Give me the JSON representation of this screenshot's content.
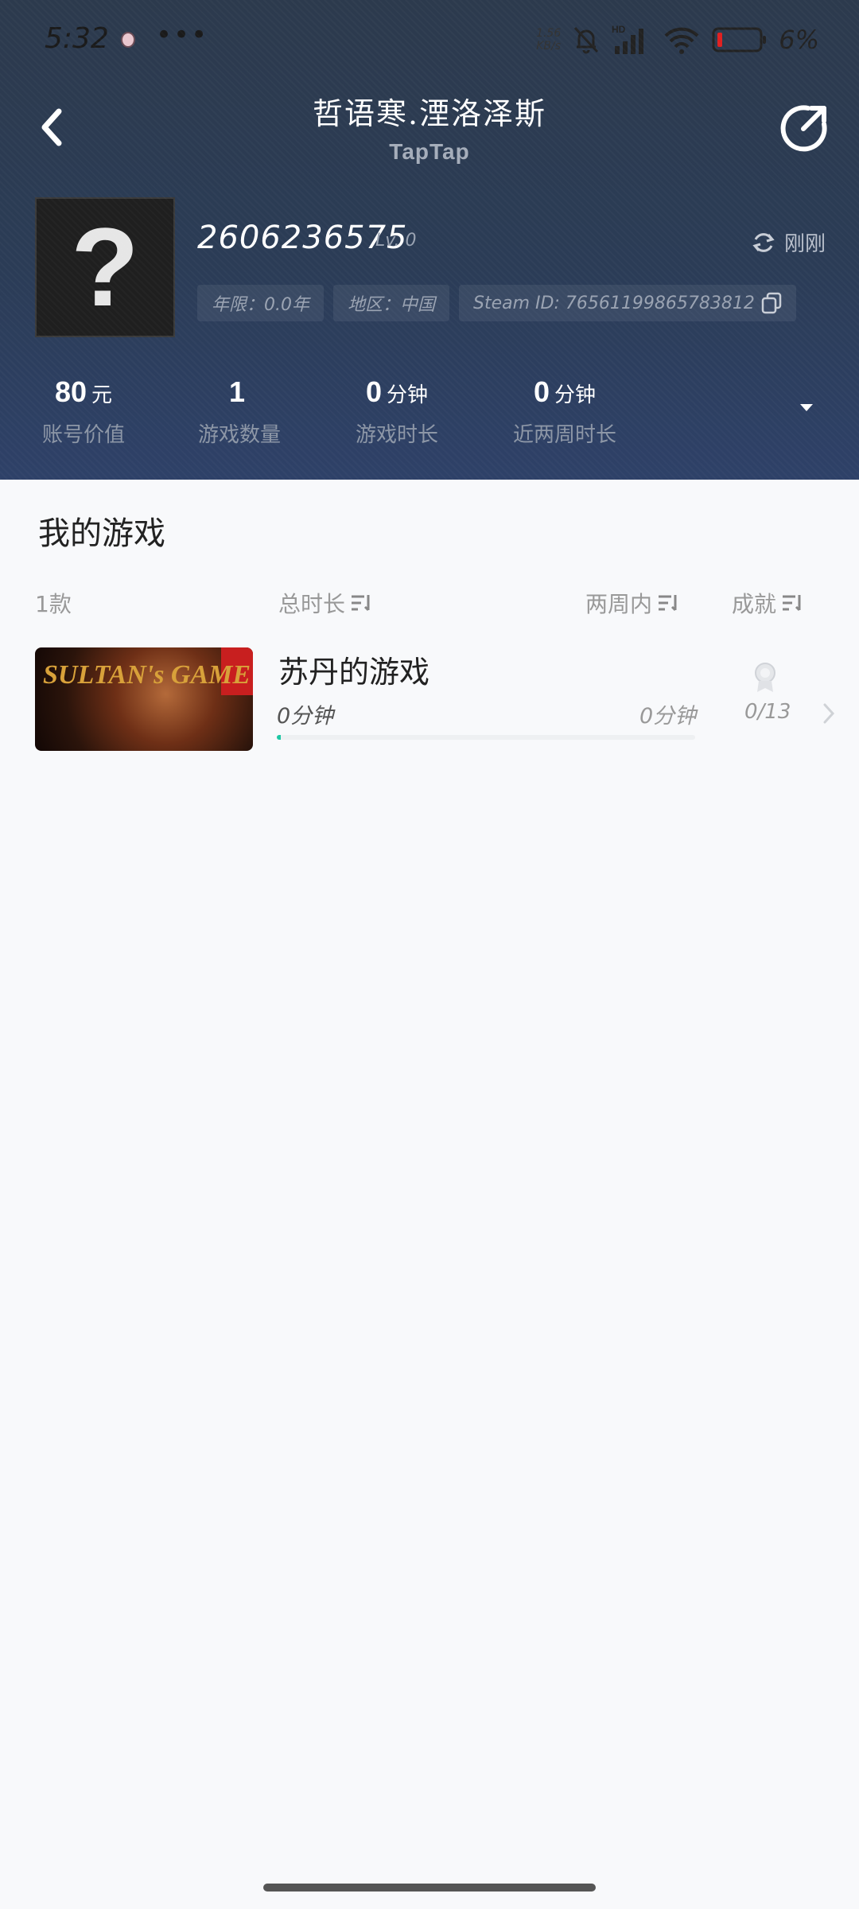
{
  "status_bar": {
    "time": "5:32",
    "dots": "•••",
    "net_speed_value": "1.56",
    "net_speed_unit": "KB/s",
    "hd_label": "HD",
    "battery_percent": "6%",
    "colors": {
      "battery_low": "#e02020"
    }
  },
  "nav": {
    "title": "哲语寒.湮洛泽斯",
    "brand": "TapTap",
    "icons": {
      "back": "chevron-left-icon",
      "share": "share-icon"
    }
  },
  "profile": {
    "avatar_glyph": "?",
    "user_id": "2606236575",
    "level": "Lv. 0",
    "refresh_label": "刚刚",
    "chips": [
      {
        "text": "年限：0.0年"
      },
      {
        "text": "地区：中国"
      },
      {
        "text": "Steam ID: 76561199865783812",
        "icon": "copy-icon"
      }
    ]
  },
  "stats": [
    {
      "value": "80",
      "unit": "元",
      "label": "账号价值"
    },
    {
      "value": "1",
      "unit": "",
      "label": "游戏数量"
    },
    {
      "value": "0",
      "unit": "分钟",
      "label": "游戏时长"
    },
    {
      "value": "0",
      "unit": "分钟",
      "label": "近两周时长"
    }
  ],
  "games_section": {
    "title": "我的游戏",
    "count_label": "1款",
    "columns": {
      "total": "总时长",
      "recent": "两周内",
      "achievement": "成就"
    },
    "items": [
      {
        "name": "苏丹的游戏",
        "cover_text": "SULTAN's GAME",
        "total_time": "0分钟",
        "recent_time": "0分钟",
        "achievements": "0/13",
        "progress": 0.01
      }
    ]
  },
  "colors": {
    "header_bg": "#2b3c56",
    "accent": "#1ec7a4",
    "page_bg": "#f8f9fb"
  }
}
